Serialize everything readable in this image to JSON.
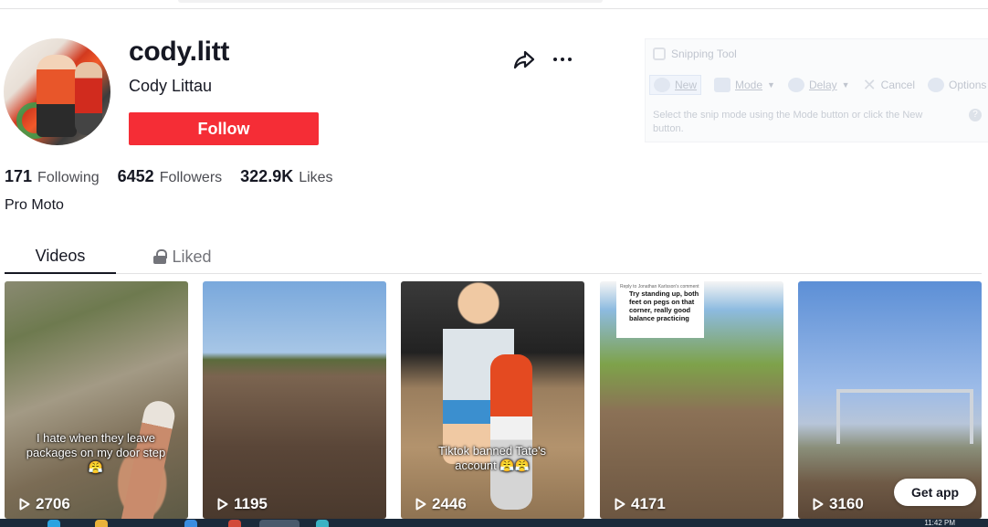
{
  "profile": {
    "username": "cody.litt",
    "nickname": "Cody Littau",
    "follow_label": "Follow",
    "bio": "Pro Moto",
    "stats": {
      "following_count": "171",
      "following_label": "Following",
      "followers_count": "6452",
      "followers_label": "Followers",
      "likes_count": "322.9K",
      "likes_label": "Likes"
    }
  },
  "tabs": {
    "videos": "Videos",
    "liked": "Liked"
  },
  "videos": [
    {
      "views": "2706",
      "caption": "I hate when they leave packages on my door step😤"
    },
    {
      "views": "1195",
      "caption": ""
    },
    {
      "views": "2446",
      "caption": "Tiktok banned Tate's account 😤😤"
    },
    {
      "views": "4171",
      "note_header": "Reply to Jonathan Karlsson's comment",
      "note_text": "Try standing up, both feet on pegs on that corner, really good balance practicing"
    },
    {
      "views": "3160",
      "caption": ""
    }
  ],
  "get_app_label": "Get app",
  "snipping_tool": {
    "title": "Snipping Tool",
    "new_label": "New",
    "mode_label": "Mode",
    "delay_label": "Delay",
    "cancel_label": "Cancel",
    "options_label": "Options",
    "description": "Select the snip mode using the Mode button or click the New button."
  },
  "taskbar": {
    "time": "11:42 PM"
  },
  "colors": {
    "follow_button": "#f52d36",
    "text_primary": "#161823",
    "text_secondary": "#73747a"
  }
}
